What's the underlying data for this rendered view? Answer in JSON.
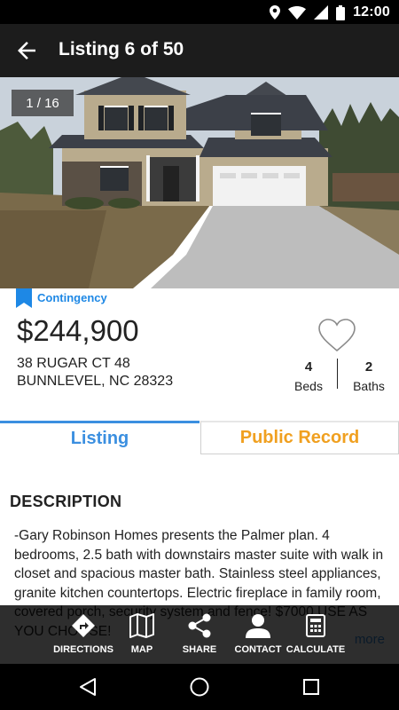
{
  "status_bar": {
    "time": "12:00",
    "icons": [
      "location-icon",
      "wifi-icon",
      "signal-icon",
      "battery-icon"
    ]
  },
  "app_bar": {
    "title": "Listing 6 of 50",
    "back_icon": "arrow-back-icon"
  },
  "photo": {
    "counter": "1 / 16"
  },
  "listing": {
    "status": "Contingency",
    "price": "$244,900",
    "address_line1": "38 RUGAR CT 48",
    "address_line2": "BUNNLEVEL, NC 28323",
    "beds_value": "4",
    "beds_label": "Beds",
    "baths_value": "2",
    "baths_label": "Baths"
  },
  "tabs": [
    {
      "label": "Listing",
      "active": true
    },
    {
      "label": "Public Record",
      "active": false
    }
  ],
  "description": {
    "title": "DESCRIPTION",
    "body": "-Gary Robinson Homes presents the Palmer plan. 4 bedrooms, 2.5 bath with downstairs master suite with walk in closet and spacious master bath. Stainless steel appliances, granite kitchen countertops. Electric fireplace in family room, covered porch, security system and fence! $7000 USE AS YOU CHOOSE!",
    "more_link": "more"
  },
  "actions": [
    {
      "label": "DIRECTIONS",
      "icon": "directions-icon"
    },
    {
      "label": "MAP",
      "icon": "map-icon"
    },
    {
      "label": "SHARE",
      "icon": "share-icon"
    },
    {
      "label": "CONTACT",
      "icon": "contact-icon"
    },
    {
      "label": "CALCULATE",
      "icon": "calculator-icon"
    }
  ],
  "colors": {
    "accent_blue": "#3b8fe0",
    "accent_orange": "#f0a020",
    "app_bar": "#1c1c1c"
  }
}
